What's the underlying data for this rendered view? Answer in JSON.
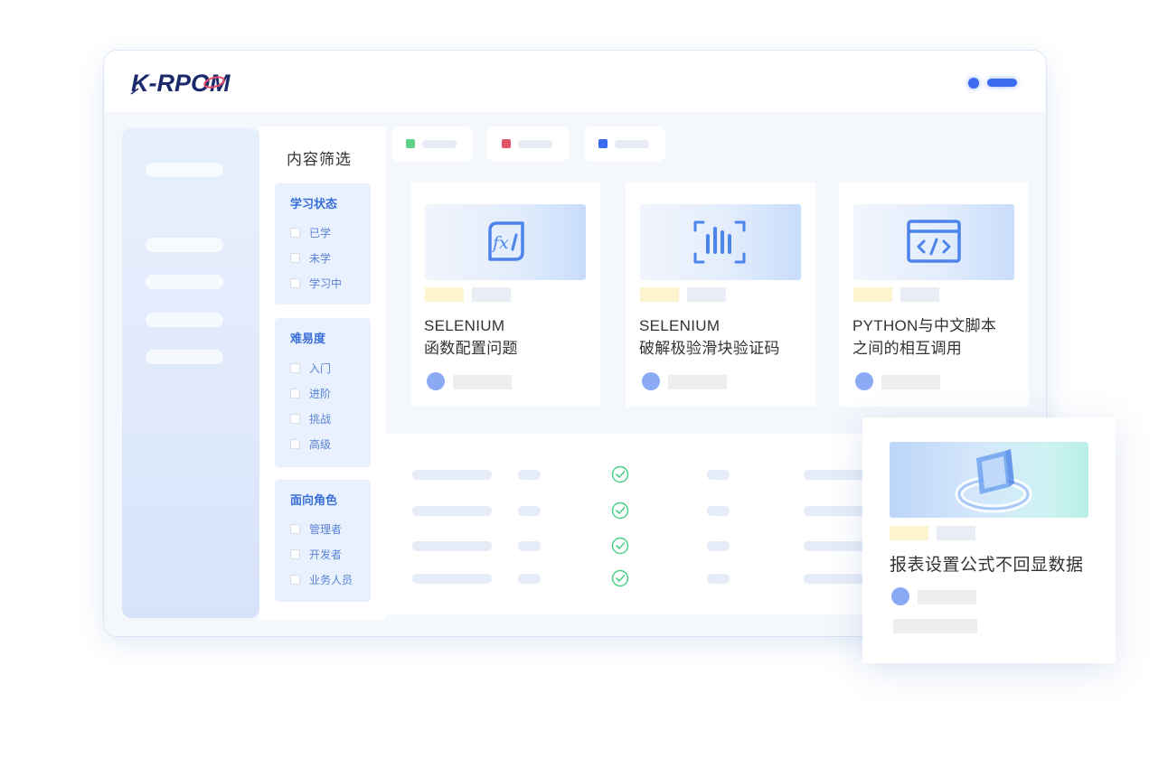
{
  "header": {
    "logo_text": "K-RPOM",
    "brand_color": "#1b2a6b",
    "accent_color": "#3b6cf0"
  },
  "filter": {
    "title": "内容筛选",
    "groups": [
      {
        "title": "学习状态",
        "items": [
          "已学",
          "未学",
          "学习中"
        ]
      },
      {
        "title": "难易度",
        "items": [
          "入门",
          "进阶",
          "挑战",
          "高级"
        ]
      },
      {
        "title": "面向角色",
        "items": [
          "管理者",
          "开发者",
          "业务人员"
        ]
      }
    ]
  },
  "tabs": [
    {
      "dot_color": "#5fd18a"
    },
    {
      "dot_color": "#e0576a"
    },
    {
      "dot_color": "#3b6cf0"
    }
  ],
  "cards": [
    {
      "title_line1": "SELENIUM",
      "title_line2": "函数配置问题",
      "icon": "function-icon"
    },
    {
      "title_line1": "SELENIUM",
      "title_line2": "破解极验滑块验证码",
      "icon": "barcode-scan-icon"
    },
    {
      "title_line1": "PYTHON与中文脚本",
      "title_line2": "之间的相互调用",
      "icon": "code-window-icon"
    }
  ],
  "table": {
    "row_count": 4,
    "status_icon": "check-circle-icon",
    "status_color": "#4cd089"
  },
  "floating_card": {
    "title": "报表设置公式不回显数据",
    "icon": "refresh-3d-icon"
  }
}
